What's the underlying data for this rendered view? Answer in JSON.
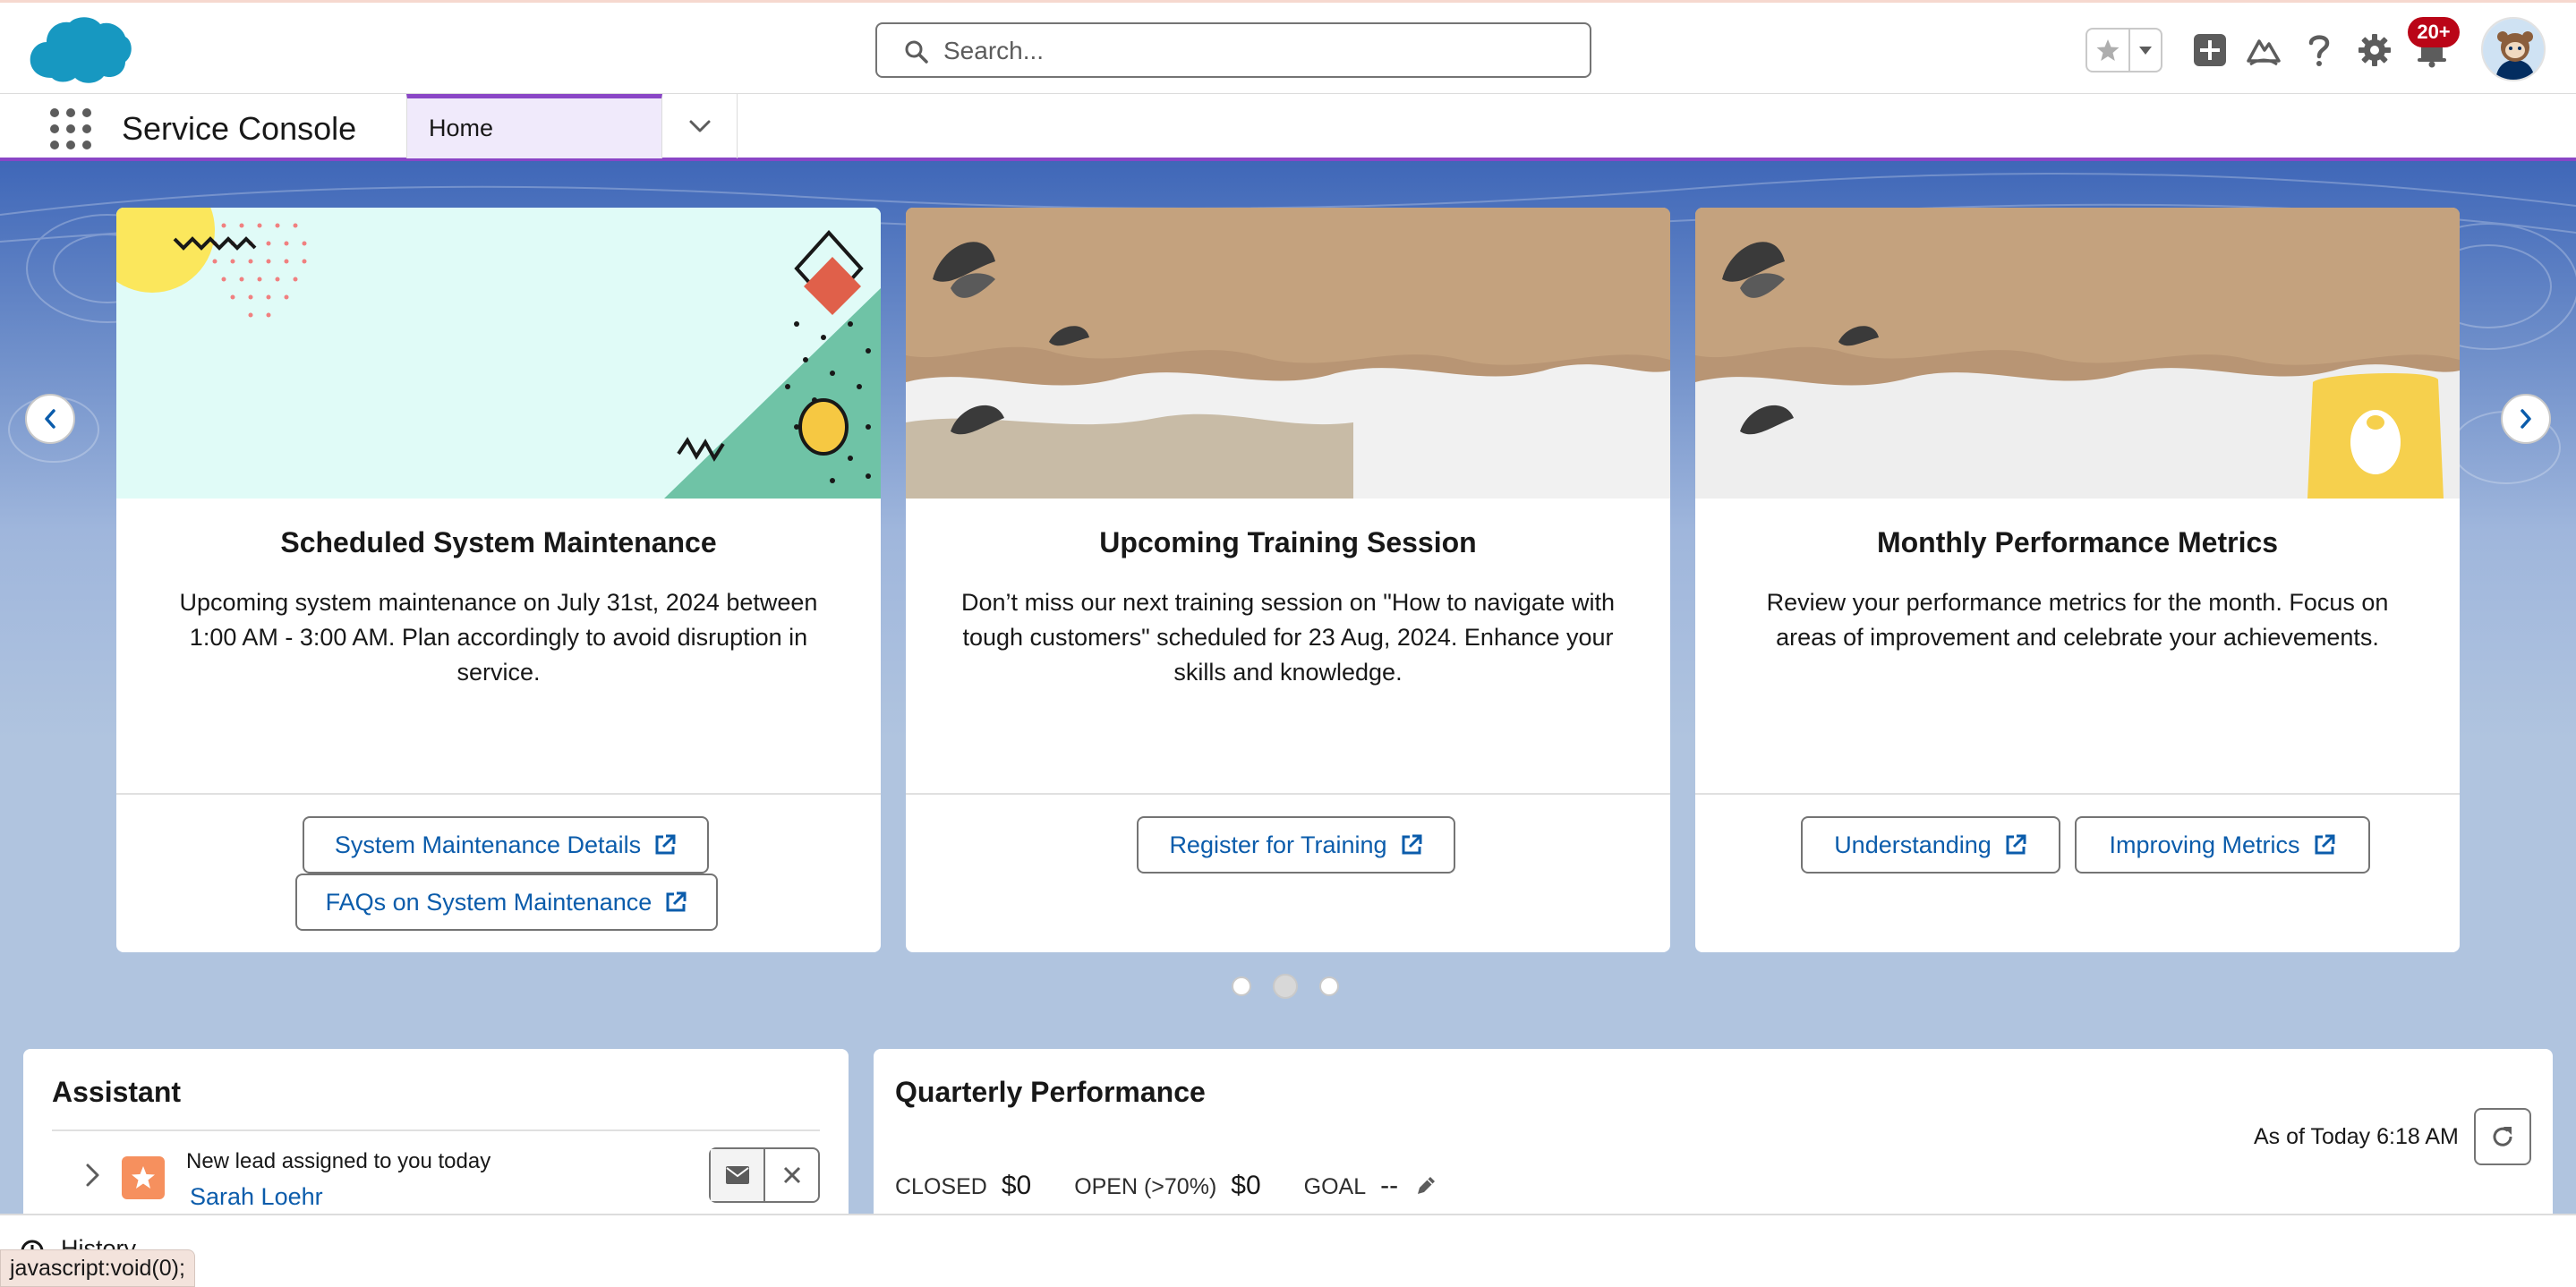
{
  "header": {
    "logo_name": "salesforce-cloud-logo",
    "search_placeholder": "Search...",
    "notification_count": "20+",
    "icons": [
      "star-icon",
      "chevron-down-icon",
      "add-icon",
      "trailhead-icon",
      "help-icon",
      "setup-gear-icon",
      "bell-icon",
      "avatar"
    ]
  },
  "nav": {
    "app_name": "Service Console",
    "tabs": [
      {
        "label": "Home",
        "active": true
      }
    ]
  },
  "carousel": {
    "cards": [
      {
        "title": "Scheduled System Maintenance",
        "body": "Upcoming system maintenance on July 31st, 2024 between 1:00 AM - 3:00 AM. Plan accordingly to avoid disruption in service.",
        "buttons": [
          "System Maintenance Details",
          "FAQs on System Maintenance"
        ]
      },
      {
        "title": "Upcoming Training Session",
        "body": "Don’t miss our next training session on \"How to navigate with tough customers\" scheduled for 23 Aug, 2024. Enhance your skills and knowledge.",
        "buttons": [
          "Register for Training"
        ]
      },
      {
        "title": "Monthly Performance Metrics",
        "body": "Review your performance metrics for the month. Focus on areas of improvement and celebrate your achievements.",
        "buttons": [
          "Understanding",
          "Improving Metrics"
        ]
      }
    ],
    "page_count": 3,
    "active_page": 2
  },
  "assistant": {
    "title": "Assistant",
    "items": [
      {
        "text": "New lead assigned to you today",
        "name": "Sarah Loehr"
      }
    ]
  },
  "quarterly_performance": {
    "title": "Quarterly Performance",
    "as_of": "As of Today 6:18 AM",
    "closed_label": "CLOSED",
    "closed_value": "$0",
    "open_label": "OPEN (>70%)",
    "open_value": "$0",
    "goal_label": "GOAL",
    "goal_value": "--"
  },
  "utility_bar": {
    "history_label": "History"
  },
  "status_bar": {
    "text": "javascript:void(0);"
  },
  "colors": {
    "brand_blue": "#0b5cab",
    "nav_accent": "#8a46c6",
    "notification_red": "#ba0517",
    "lead_orange": "#f6905e"
  }
}
